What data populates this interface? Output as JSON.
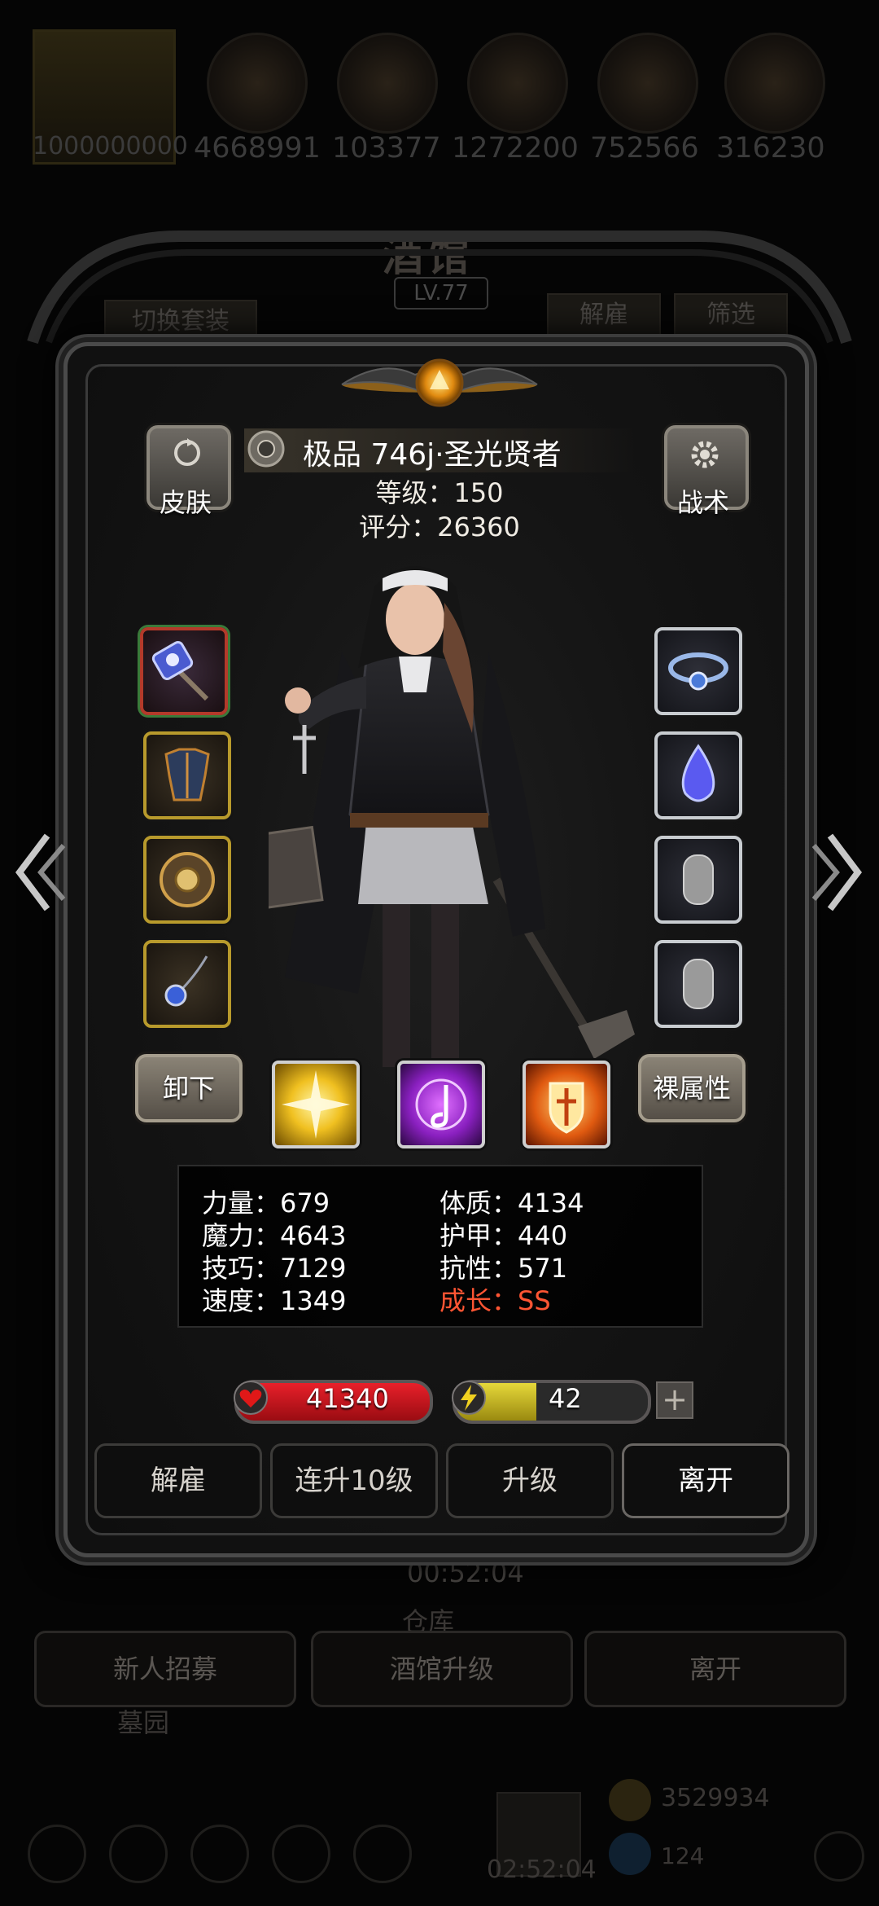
{
  "resources": [
    {
      "name": "gold",
      "value": "1000000000",
      "icon": "crown-icon"
    },
    {
      "value": "4668991",
      "icon": "orange-ore-icon"
    },
    {
      "value": "103377",
      "icon": "amber-ore-icon"
    },
    {
      "value": "1272200",
      "icon": "silver-ingot-icon"
    },
    {
      "value": "752566",
      "icon": "blue-feather-icon"
    },
    {
      "value": "316230",
      "icon": "grey-ore-icon"
    }
  ],
  "background": {
    "title": "酒馆",
    "level": "LV.77",
    "switch_set_label": "切换套装",
    "dismiss_label": "解雇",
    "filter_label": "筛选",
    "timer": "00:52:04",
    "warehouse_label": "仓库",
    "buttons": [
      "新人招募",
      "酒馆升级",
      "离开"
    ],
    "legion_label": "墓园",
    "bottom_timer": "02:52:04",
    "bottom_count": "3529934",
    "bottom_count2": "124"
  },
  "hero": {
    "skin_label": "皮肤",
    "tactics_label": "战术",
    "name": "极品 746j·圣光贤者",
    "level_text": "等级：150",
    "score_text": "评分：26360",
    "unequip_label": "卸下",
    "naked_attr_label": "裸属性"
  },
  "equipment": {
    "left": [
      {
        "name": "weapon-hammer",
        "icon": "hammer-icon"
      },
      {
        "name": "armor",
        "icon": "armor-icon"
      },
      {
        "name": "shield",
        "icon": "shield-icon"
      },
      {
        "name": "amulet",
        "icon": "amulet-icon"
      }
    ],
    "right": [
      {
        "name": "ring",
        "icon": "ring-icon"
      },
      {
        "name": "gem",
        "icon": "gem-icon"
      },
      {
        "name": "empty-slot-1",
        "icon": "empty-slot-icon"
      },
      {
        "name": "empty-slot-2",
        "icon": "empty-slot-icon"
      }
    ]
  },
  "skills": [
    {
      "name": "holy-light",
      "icon": "burst-icon",
      "color": "#f4d23a"
    },
    {
      "name": "music-note",
      "icon": "note-icon",
      "color": "#b050e0"
    },
    {
      "name": "holy-shield",
      "icon": "shield-glow-icon",
      "color": "#f07828"
    }
  ],
  "stats": {
    "strength": "力量：679",
    "constitution": "体质：4134",
    "magic": "魔力：4643",
    "armor": "护甲：440",
    "skill": "技巧：7129",
    "resistance": "抗性：571",
    "speed": "速度：1349",
    "growth": "成长：SS"
  },
  "bars": {
    "hp": "41340",
    "energy": "42",
    "energy_fraction": 0.42,
    "plus": "+"
  },
  "actions": {
    "dismiss": "解雇",
    "level_up_10": "连升10级",
    "level_up": "升级",
    "leave": "离开"
  },
  "colors": {
    "hp": "#e8202a",
    "energy": "#e6d83a",
    "growth": "#ff5533",
    "gold_frame": "#b89a2c"
  }
}
